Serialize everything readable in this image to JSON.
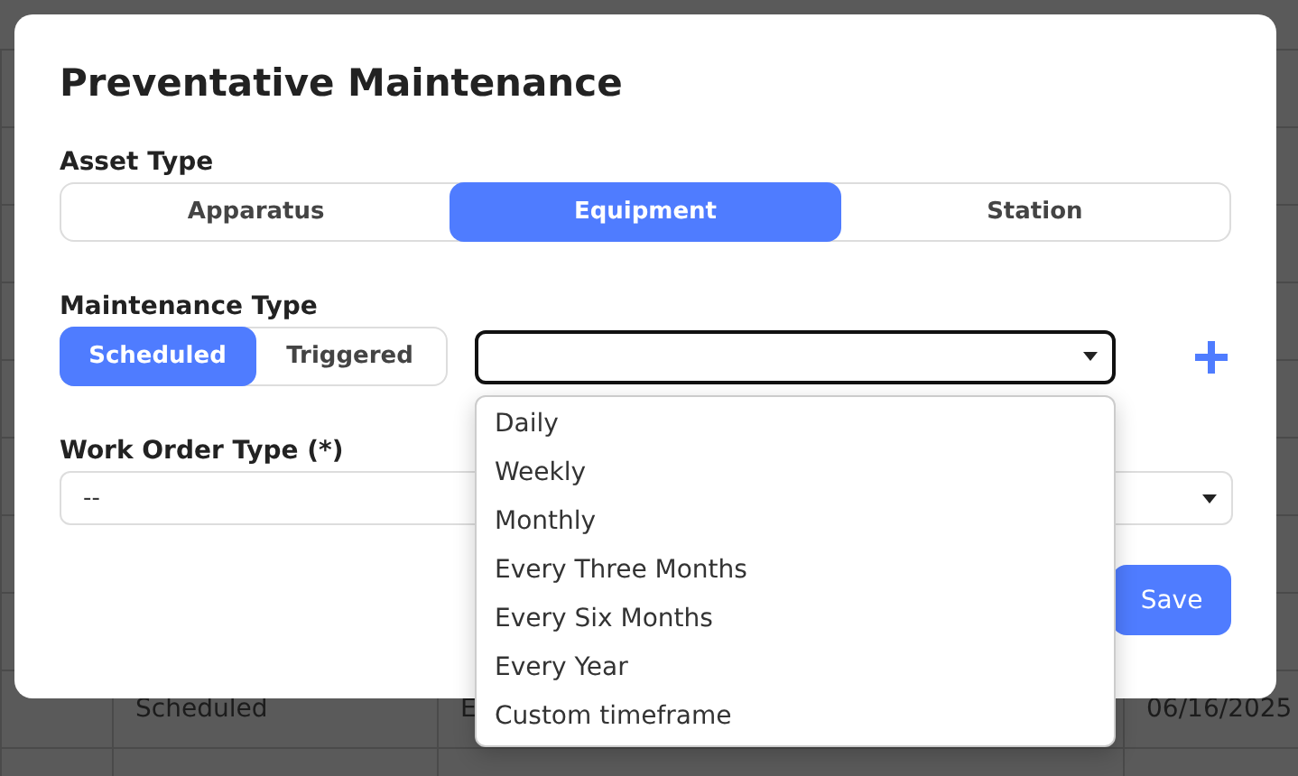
{
  "background_table": {
    "row": [
      "Scheduled",
      "E",
      "06/16/2025"
    ]
  },
  "dialog": {
    "title": "Preventative Maintenance",
    "asset_type": {
      "label": "Asset Type",
      "options": [
        {
          "label": "Apparatus",
          "selected": false
        },
        {
          "label": "Equipment",
          "selected": true
        },
        {
          "label": "Station",
          "selected": false
        }
      ]
    },
    "maintenance_type": {
      "label": "Maintenance Type",
      "options": [
        {
          "label": "Scheduled",
          "selected": true
        },
        {
          "label": "Triggered",
          "selected": false
        }
      ],
      "frequency": {
        "expanded": true,
        "options": [
          "Daily",
          "Weekly",
          "Monthly",
          "Every Three Months",
          "Every Six Months",
          "Every Year",
          "Custom timeframe"
        ]
      }
    },
    "work_order_type": {
      "label": "Work Order Type (*)",
      "value": "--"
    },
    "buttons": [
      "Save"
    ]
  }
}
